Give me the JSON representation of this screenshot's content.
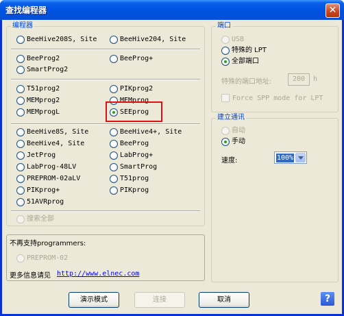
{
  "window": {
    "title": "查找编程器",
    "close_glyph": "✕"
  },
  "programmers": {
    "legend": "编程器",
    "row1": [
      "BeeHive208S, Site",
      "BeeHive204, Site"
    ],
    "row2": [
      "BeeProg2",
      "BeeProg+",
      "SmartProg2"
    ],
    "row3": [
      "T51prog2",
      "PIKprog2",
      "MEMprog2",
      "MEMprog",
      "MEMprogL",
      "SEEprog"
    ],
    "row4": [
      "BeeHive8S, Site",
      "BeeHive4+, Site",
      "BeeHive4, Site",
      "BeeProg",
      "JetProg",
      "LabProg+",
      "LabProg-48LV",
      "SmartProg",
      "PREPROM-02aLV",
      "T51prog",
      "PIKprog+",
      "PIKprog",
      "51AVRprog"
    ],
    "selected": "SEEprog",
    "search_all": "搜索全部"
  },
  "unsupported": {
    "title": "不再支持programmers:",
    "item": "PREPROM-02",
    "more_info_label": "更多信息请见",
    "more_info_link": "http://www.elnec.com"
  },
  "port": {
    "legend": "端口",
    "usb": "USB",
    "special_lpt": "特殊的 LPT",
    "all_ports": "全部端口",
    "selected": "全部端口",
    "address_label": "特殊的端口地址:",
    "address_value": "200",
    "address_unit": "h",
    "force_spp": "Force SPP mode for LPT"
  },
  "comm": {
    "legend": "建立通讯",
    "auto": "自动",
    "manual": "手动",
    "selected": "手动",
    "speed_label": "速度:",
    "speed_value": "100%"
  },
  "buttons": {
    "demo": "演示模式",
    "connect": "连接",
    "cancel": "取消",
    "help": "?"
  },
  "colors": {
    "title_bar": "#0054e3",
    "dialog_bg": "#ece9d8",
    "highlight_box": "#e01010",
    "radio_dot": "#21a121"
  }
}
